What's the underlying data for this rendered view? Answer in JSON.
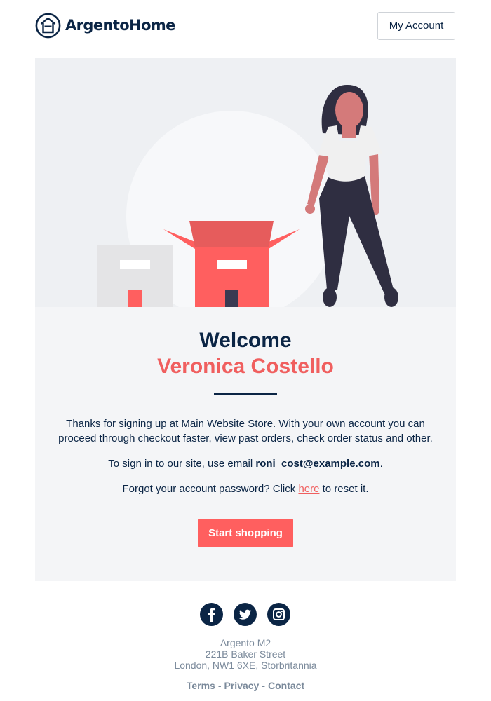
{
  "header": {
    "logo_text": "ArgentoHome",
    "account_button": "My Account"
  },
  "hero": {
    "illustration": "woman-with-boxes-illustration"
  },
  "main": {
    "welcome_title": "Welcome",
    "customer_name": "Veronica Costello",
    "paragraph1": "Thanks for signing up at Main Website Store. With your own account you can proceed through checkout faster, view past orders, check order status and other.",
    "signin_prefix": "To sign in to our site, use email ",
    "signin_email": "roni_cost@example.com",
    "signin_suffix": ".",
    "forgot_prefix": "Forgot your account password? Click ",
    "forgot_link": "here",
    "forgot_suffix": " to reset it.",
    "cta_button": "Start shopping"
  },
  "social": {
    "icons": [
      "facebook-icon",
      "twitter-icon",
      "instagram-icon"
    ]
  },
  "footer": {
    "address_line1": "Argento M2",
    "address_line2": "221B Baker Street",
    "address_line3": "London, NW1 6XE, Storbritannia",
    "link_terms": "Terms",
    "link_privacy": "Privacy",
    "link_contact": "Contact",
    "separator": "-"
  },
  "colors": {
    "navy": "#0b2545",
    "coral": "#ff5f5f",
    "muted": "#7b8a9b",
    "card_bg": "#f4f5f7"
  }
}
